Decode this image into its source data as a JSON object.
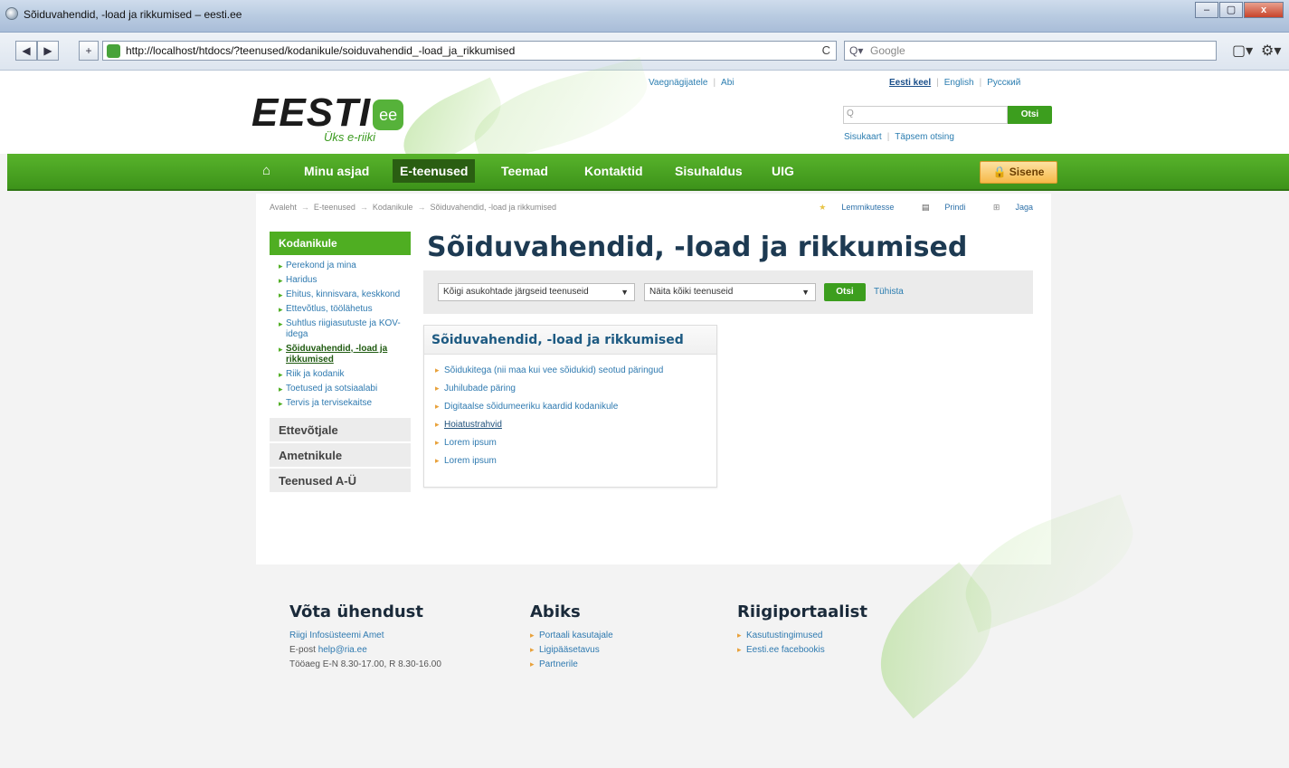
{
  "browser": {
    "window_title": "Sõiduvahendid, -load ja rikkumised – eesti.ee",
    "url": "http://localhost/htdocs/?teenused/kodanikule/soiduvahendid_-load_ja_rikkumised",
    "search_placeholder": "Google",
    "back": "◀",
    "forward": "▶",
    "new_tab": "+",
    "reload": "C",
    "page_menu": "▢▾",
    "tools_menu": "⚙▾",
    "min": "–",
    "max": "▢",
    "close": "x"
  },
  "header": {
    "logo_word": "EESTI",
    "logo_mark": "ee",
    "logo_tagline": "Üks e-riiki",
    "top_links": [
      "Vaegnägijatele",
      "Abi"
    ],
    "languages": [
      "Eesti keel",
      "English",
      "Русский"
    ],
    "search_button": "Otsi",
    "search_links": [
      "Sisukaart",
      "Täpsem otsing"
    ]
  },
  "nav": {
    "home_icon": "⌂",
    "items": [
      "Minu asjad",
      "E-teenused",
      "Teemad",
      "Kontaktid",
      "Sisuhaldus",
      "UIG"
    ],
    "active": "E-teenused",
    "login": "Sisene"
  },
  "breadcrumb": [
    "Avaleht",
    "E-teenused",
    "Kodanikule",
    "Sõiduvahendid, -load ja rikkumised"
  ],
  "page_tools": [
    "Lemmikutesse",
    "Prindi",
    "Jaga"
  ],
  "sidebar": {
    "heading": "Kodanikule",
    "items": [
      "Perekond ja mina",
      "Haridus",
      "Ehitus, kinnisvara, keskkond",
      "Ettevõtlus, töölähetus",
      "Suhtlus riigiasutuste ja KOV-idega",
      "Sõiduvahendid, -load ja rikkumised",
      "Riik ja kodanik",
      "Toetused ja sotsiaalabi",
      "Tervis ja tervisekaitse"
    ],
    "active_index": 5,
    "groups": [
      "Ettevõtjale",
      "Ametnikule",
      "Teenused A-Ü"
    ]
  },
  "main": {
    "title": "Sõiduvahendid, -load ja rikkumised",
    "filter": {
      "location_select": "Kõigi asukohtade järgseid teenuseid",
      "type_select": "Näita kõiki teenuseid",
      "search_button": "Otsi",
      "cancel_link": "Tühista"
    },
    "box": {
      "title": "Sõiduvahendid, -load ja rikkumised",
      "links": [
        "Sõidukitega (nii maa kui vee sõidukid) seotud päringud",
        "Juhilubade päring",
        "Digitaalse sõidumeeriku kaardid kodanikule",
        "Hoiatustrahvid",
        "Lorem ipsum",
        "Lorem ipsum"
      ]
    }
  },
  "footer": {
    "contact": {
      "title": "Võta ühendust",
      "org": "Riigi Infosüsteemi Amet",
      "email_label": "E-post",
      "email": "help@ria.ee",
      "hours": "Tööaeg E-N 8.30-17.00, R 8.30-16.00"
    },
    "help": {
      "title": "Abiks",
      "links": [
        "Portaali kasutajale",
        "Ligipääsetavus",
        "Partnerile"
      ]
    },
    "portal": {
      "title": "Riigiportaalist",
      "links": [
        "Kasutustingimused",
        "Eesti.ee facebookis"
      ]
    }
  }
}
